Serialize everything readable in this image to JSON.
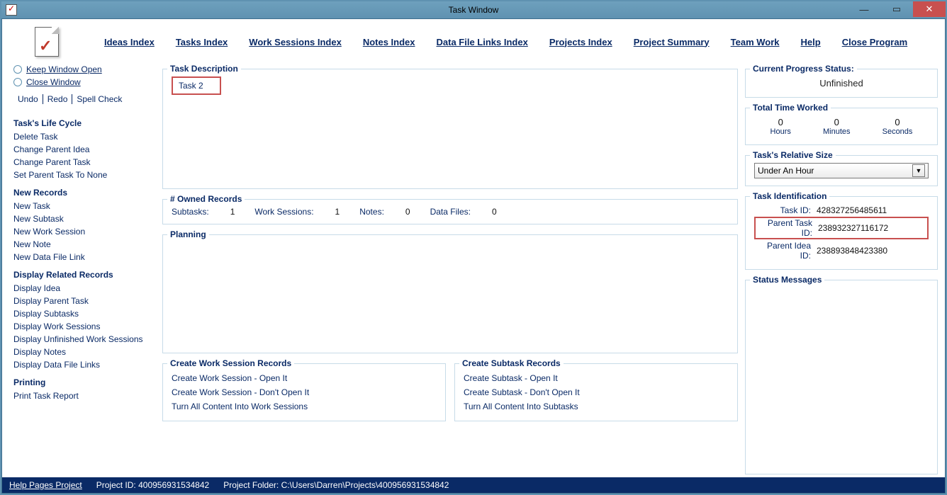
{
  "window": {
    "title": "Task Window"
  },
  "menubar": {
    "ideas_index": "Ideas Index",
    "tasks_index": "Tasks Index",
    "work_sessions_index": "Work Sessions Index",
    "notes_index": "Notes Index",
    "data_file_links_index": "Data File Links Index",
    "projects_index": "Projects Index",
    "project_summary": "Project Summary",
    "team_work": "Team Work",
    "help": "Help",
    "close_program": "Close Program"
  },
  "left": {
    "keep_window_open": "Keep Window Open",
    "close_window": "Close Window",
    "undo": "Undo",
    "redo": "Redo",
    "spell": "Spell Check",
    "task_life_cycle": "Task's Life Cycle",
    "delete_task": "Delete Task",
    "change_parent_idea": "Change Parent Idea",
    "change_parent_task": "Change Parent Task",
    "set_parent_none": "Set Parent Task To None",
    "new_records": "New Records",
    "new_task": "New Task",
    "new_subtask": "New Subtask",
    "new_ws": "New Work Session",
    "new_note": "New Note",
    "new_dfl": "New Data File Link",
    "display_related": "Display Related Records",
    "disp_idea": "Display Idea",
    "disp_parent_task": "Display Parent Task",
    "disp_subtasks": "Display Subtasks",
    "disp_ws": "Display Work Sessions",
    "disp_unfinished_ws": "Display Unfinished Work Sessions",
    "disp_notes": "Display Notes",
    "disp_dfl": "Display Data File Links",
    "printing": "Printing",
    "print_report": "Print Task Report"
  },
  "center": {
    "task_description_legend": "Task Description",
    "task_description_value": "Task 2",
    "owned_legend": "# Owned Records",
    "subtasks_label": "Subtasks:",
    "subtasks_value": "1",
    "ws_label": "Work Sessions:",
    "ws_value": "1",
    "notes_label": "Notes:",
    "notes_value": "0",
    "df_label": "Data Files:",
    "df_value": "0",
    "planning_legend": "Planning",
    "cwsr_legend": "Create Work Session Records",
    "cws_open": "Create Work Session - Open It",
    "cws_noopen": "Create Work Session - Don't Open It",
    "turn_ws": "Turn All Content Into Work Sessions",
    "csr_legend": "Create Subtask Records",
    "cs_open": "Create Subtask - Open It",
    "cs_noopen": "Create Subtask - Don't Open It",
    "turn_st": "Turn All Content Into Subtasks"
  },
  "right": {
    "progress_legend": "Current Progress Status:",
    "progress_value": "Unfinished",
    "time_legend": "Total Time Worked",
    "hours_n": "0",
    "hours_u": "Hours",
    "minutes_n": "0",
    "minutes_u": "Minutes",
    "seconds_n": "0",
    "seconds_u": "Seconds",
    "size_legend": "Task's Relative Size",
    "size_value": "Under An Hour",
    "ident_legend": "Task Identification",
    "task_id_label": "Task ID:",
    "task_id_value": "428327256485611",
    "parent_task_id_label": "Parent Task ID:",
    "parent_task_id_value": "238932327116172",
    "parent_idea_id_label": "Parent Idea ID:",
    "parent_idea_id_value": "238893848423380",
    "status_msgs_legend": "Status Messages"
  },
  "footer": {
    "help_pages": "Help Pages Project",
    "project_id_label": "Project ID:",
    "project_id_value": "400956931534842",
    "project_folder_label": "Project Folder:",
    "project_folder_value": "C:\\Users\\Darren\\Projects\\400956931534842"
  }
}
